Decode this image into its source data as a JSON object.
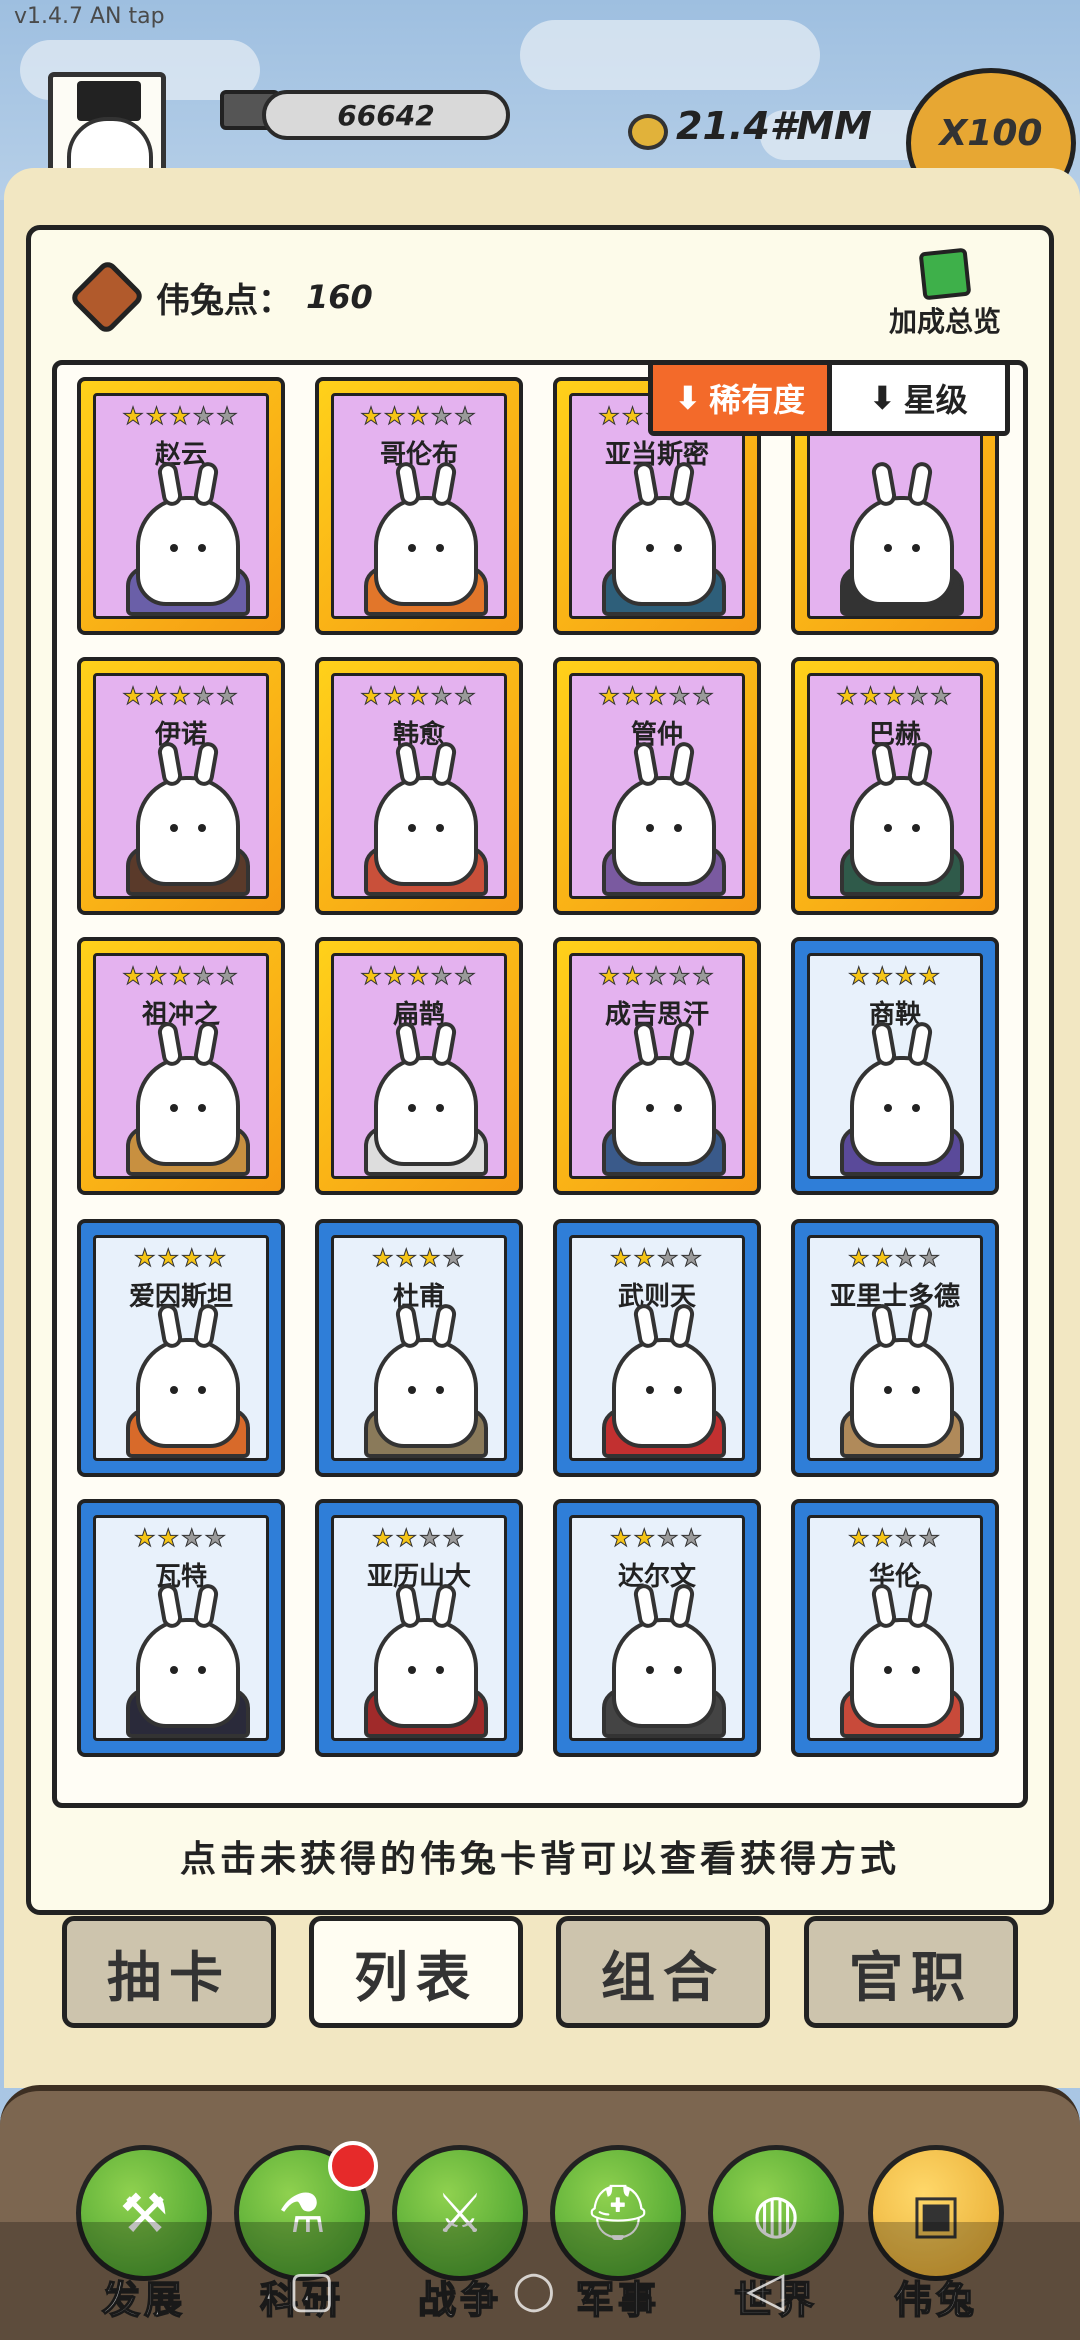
{
  "status": {
    "version": "v1.4.7 AN tap"
  },
  "top": {
    "resource_value": "66642",
    "coin_value": "21.4#MM",
    "multiplier": "X100"
  },
  "header": {
    "points_label": "伟兔点：",
    "points_value": "160",
    "bonus_label": "加成总览"
  },
  "sort": {
    "rarity_label": "稀有度",
    "star_label": "星级"
  },
  "cards": [
    {
      "name": "赵云",
      "stars": 3,
      "max": 5,
      "frame": "gold"
    },
    {
      "name": "哥伦布",
      "stars": 3,
      "max": 5,
      "frame": "gold"
    },
    {
      "name": "亚当斯密",
      "stars": 2,
      "max": 5,
      "frame": "gold"
    },
    {
      "name": "",
      "stars": 3,
      "max": 5,
      "frame": "gold"
    },
    {
      "name": "伊诺",
      "stars": 3,
      "max": 5,
      "frame": "gold"
    },
    {
      "name": "韩愈",
      "stars": 3,
      "max": 5,
      "frame": "gold"
    },
    {
      "name": "管仲",
      "stars": 3,
      "max": 5,
      "frame": "gold"
    },
    {
      "name": "巴赫",
      "stars": 3,
      "max": 5,
      "frame": "gold"
    },
    {
      "name": "祖冲之",
      "stars": 3,
      "max": 5,
      "frame": "gold"
    },
    {
      "name": "扁鹊",
      "stars": 3,
      "max": 5,
      "frame": "gold"
    },
    {
      "name": "成吉思汗",
      "stars": 2,
      "max": 5,
      "frame": "gold"
    },
    {
      "name": "商鞅",
      "stars": 4,
      "max": 4,
      "frame": "blue"
    },
    {
      "name": "爱因斯坦",
      "stars": 4,
      "max": 4,
      "frame": "blue"
    },
    {
      "name": "杜甫",
      "stars": 3,
      "max": 4,
      "frame": "blue"
    },
    {
      "name": "武则天",
      "stars": 2,
      "max": 4,
      "frame": "blue"
    },
    {
      "name": "亚里士多德",
      "stars": 2,
      "max": 4,
      "frame": "blue"
    },
    {
      "name": "瓦特",
      "stars": 2,
      "max": 4,
      "frame": "blue"
    },
    {
      "name": "亚历山大",
      "stars": 2,
      "max": 4,
      "frame": "blue"
    },
    {
      "name": "达尔文",
      "stars": 2,
      "max": 4,
      "frame": "blue"
    },
    {
      "name": "华伦",
      "stars": 2,
      "max": 4,
      "frame": "blue"
    }
  ],
  "hint": "点击未获得的伟兔卡背可以查看获得方式",
  "tabs": [
    {
      "label": "抽卡"
    },
    {
      "label": "列表"
    },
    {
      "label": "组合"
    },
    {
      "label": "官职"
    }
  ],
  "nav": [
    {
      "label": "发展",
      "icon": "shovel-icon"
    },
    {
      "label": "科研",
      "icon": "flask-icon"
    },
    {
      "label": "战争",
      "icon": "crossed-swords-icon"
    },
    {
      "label": "军事",
      "icon": "helmet-icon"
    },
    {
      "label": "世界",
      "icon": "globe-icon"
    },
    {
      "label": "伟兔",
      "icon": "card-icon"
    }
  ]
}
